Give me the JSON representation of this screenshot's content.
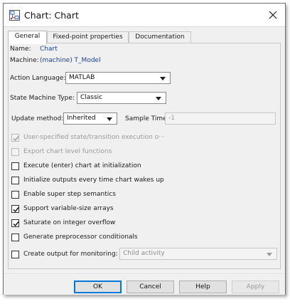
{
  "window": {
    "title": "Chart: Chart",
    "app_icon": "stateflow-chart-icon",
    "close_icon": "close-icon"
  },
  "tabs": [
    {
      "label": "General",
      "active": true
    },
    {
      "label": "Fixed-point properties",
      "active": false
    },
    {
      "label": "Documentation",
      "active": false
    }
  ],
  "info": {
    "name_label": "Name:",
    "name_value": "Chart",
    "machine_label": "Machine:",
    "machine_value": "(machine) T_Model"
  },
  "action_language": {
    "label": "Action Language:",
    "value": "MATLAB"
  },
  "state_machine_type": {
    "label": "State Machine Type:",
    "value": "Classic"
  },
  "update_method": {
    "label": "Update method:",
    "value": "Inherited"
  },
  "sample_time": {
    "label": "Sample Time:",
    "value": "-1"
  },
  "options": [
    {
      "label": "User-specified state/transition execution o···",
      "checked": true,
      "enabled": false
    },
    {
      "label": "Export chart level functions",
      "checked": false,
      "enabled": false
    },
    {
      "label": "Execute (enter) chart at initialization",
      "checked": false,
      "enabled": true
    },
    {
      "label": "Initialize outputs every time chart wakes up",
      "checked": false,
      "enabled": true
    },
    {
      "label": "Enable super step semantics",
      "checked": false,
      "enabled": true
    },
    {
      "label": "Support variable-size arrays",
      "checked": true,
      "enabled": true
    },
    {
      "label": "Saturate on integer overflow",
      "checked": true,
      "enabled": true
    },
    {
      "label": "Generate preprocessor conditionals",
      "checked": false,
      "enabled": true
    }
  ],
  "monitoring": {
    "label": "Create output for monitoring:",
    "checked": false,
    "value": "Child activity"
  },
  "buttons": {
    "ok": "OK",
    "cancel": "Cancel",
    "help": "Help",
    "apply": "Apply"
  },
  "colors": {
    "accent": "#0078d7",
    "link": "#1b3fa0",
    "disabled_text": "#9a9a9a"
  }
}
